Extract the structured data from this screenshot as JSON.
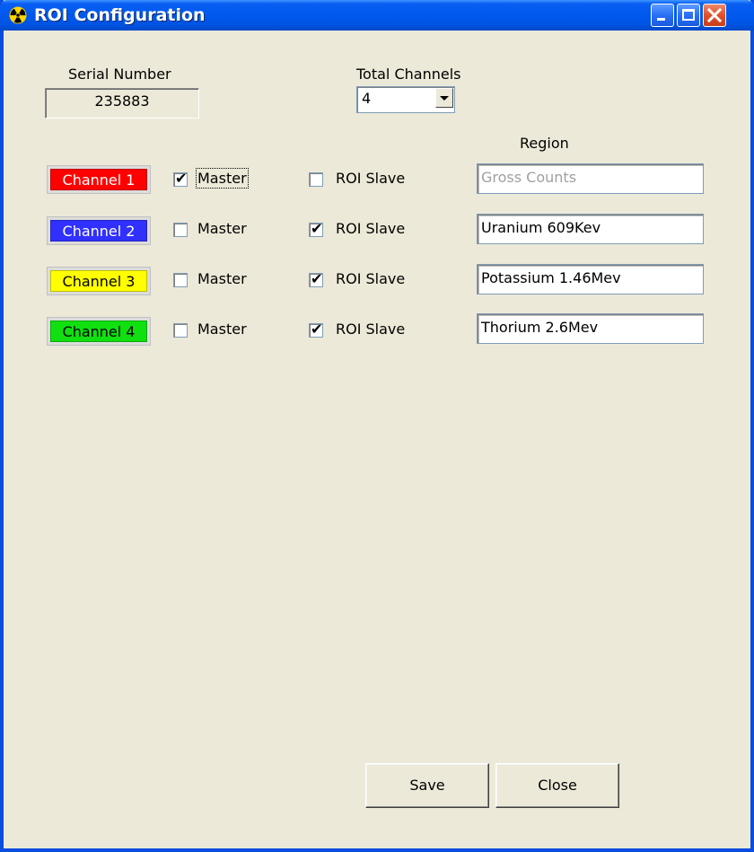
{
  "window": {
    "title": "ROI Configuration"
  },
  "serial": {
    "label": "Serial Number",
    "value": "235883"
  },
  "total_channels": {
    "label": "Total Channels",
    "value": "4"
  },
  "region_header": "Region",
  "channels": [
    {
      "label": "Channel 1",
      "color": "#ff0000",
      "text_color": "#ffffff",
      "master": true,
      "master_label": "Master",
      "slave": false,
      "slave_label": "ROI Slave",
      "region": "Gross Counts",
      "region_disabled": true
    },
    {
      "label": "Channel 2",
      "color": "#3030ff",
      "text_color": "#ffffff",
      "master": false,
      "master_label": "Master",
      "slave": true,
      "slave_label": "ROI Slave",
      "region": "Uranium 609Kev",
      "region_disabled": false
    },
    {
      "label": "Channel 3",
      "color": "#ffff00",
      "text_color": "#000000",
      "master": false,
      "master_label": "Master",
      "slave": true,
      "slave_label": "ROI Slave",
      "region": "Potassium 1.46Mev",
      "region_disabled": false
    },
    {
      "label": "Channel 4",
      "color": "#10e010",
      "text_color": "#000000",
      "master": false,
      "master_label": "Master",
      "slave": true,
      "slave_label": "ROI Slave",
      "region": "Thorium 2.6Mev",
      "region_disabled": false
    }
  ],
  "buttons": {
    "save": "Save",
    "close": "Close"
  },
  "icons": {
    "title": "radiation-icon",
    "minimize": "minimize-icon",
    "maximize": "maximize-icon",
    "close": "close-icon",
    "dropdown": "chevron-down-icon",
    "check": "checkmark-icon"
  }
}
